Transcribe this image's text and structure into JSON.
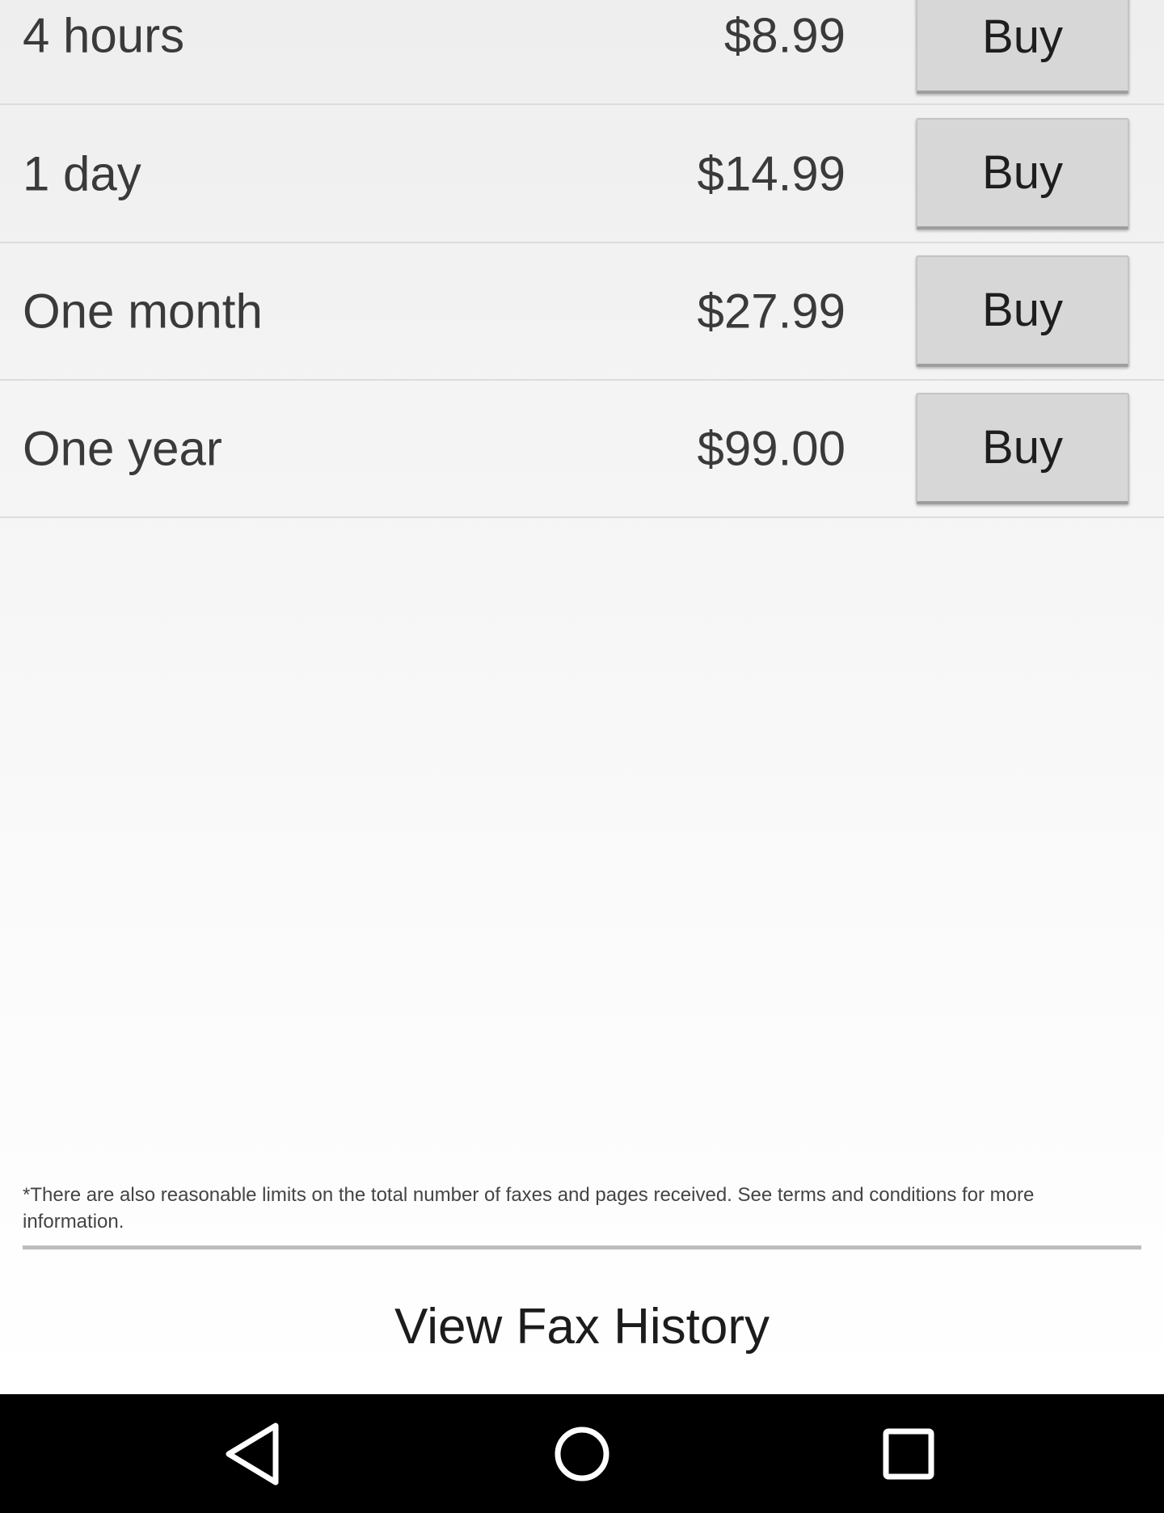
{
  "plans": [
    {
      "name": "4 hours",
      "price": "$8.99",
      "button_label": "Buy"
    },
    {
      "name": "1 day",
      "price": "$14.99",
      "button_label": "Buy"
    },
    {
      "name": "One month",
      "price": "$27.99",
      "button_label": "Buy"
    },
    {
      "name": "One year",
      "price": "$99.00",
      "button_label": "Buy"
    }
  ],
  "disclaimer": "*There are also reasonable limits on the total number of faxes and pages received. See terms and conditions for more information.",
  "fax_history_label": "View Fax History",
  "nav": {
    "back_icon": "back-triangle-icon",
    "home_icon": "home-circle-icon",
    "recents_icon": "recents-square-icon"
  },
  "colors": {
    "button_bg": "#d7d7d7",
    "text": "#3a3a3a",
    "nav_bg": "#000000"
  }
}
